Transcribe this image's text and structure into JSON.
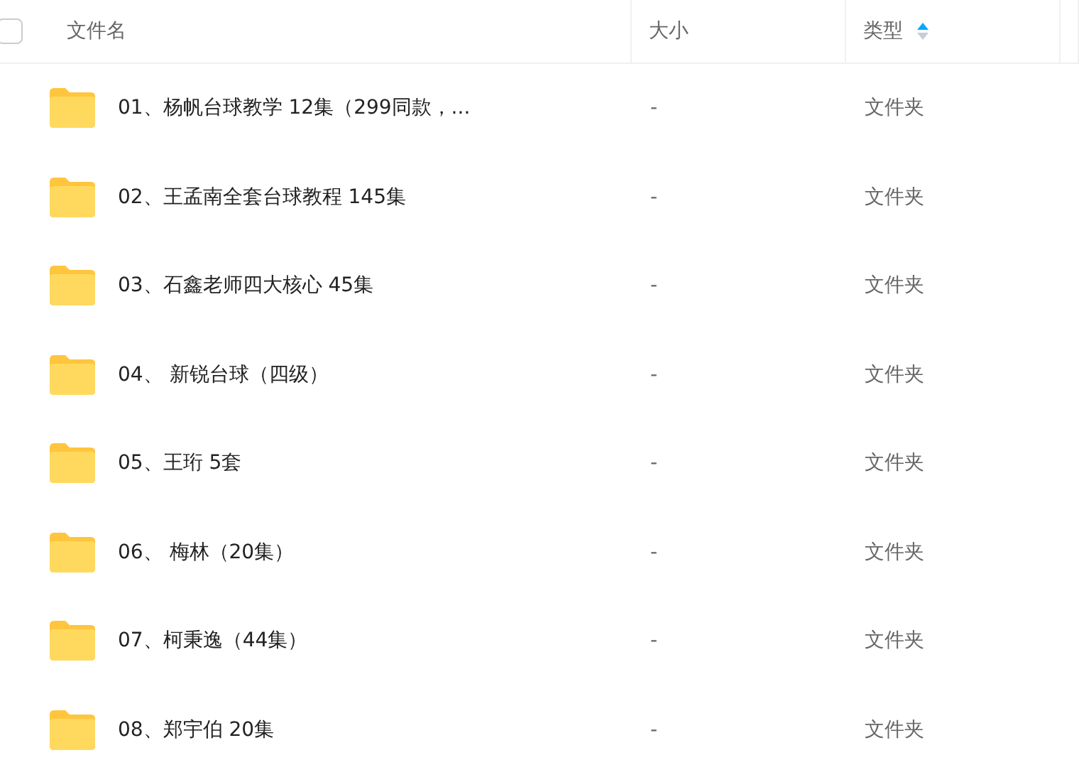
{
  "header": {
    "select_all": {
      "checked": false
    },
    "columns": [
      {
        "label": "文件名",
        "sorted": false
      },
      {
        "label": "大小",
        "sorted": false
      },
      {
        "label": "类型",
        "sorted": true
      }
    ]
  },
  "rows": [
    {
      "name": "01、杨帆台球教学 12集（299同款，...",
      "size": "-",
      "type": "文件夹"
    },
    {
      "name": "02、王孟南全套台球教程 145集",
      "size": "-",
      "type": "文件夹"
    },
    {
      "name": "03、石鑫老师四大核心 45集",
      "size": "-",
      "type": "文件夹"
    },
    {
      "name": "04、 新锐台球（四级）",
      "size": "-",
      "type": "文件夹"
    },
    {
      "name": "05、王珩 5套",
      "size": "-",
      "type": "文件夹"
    },
    {
      "name": "06、 梅林（20集）",
      "size": "-",
      "type": "文件夹"
    },
    {
      "name": "07、柯秉逸（44集）",
      "size": "-",
      "type": "文件夹"
    },
    {
      "name": "08、郑宇伯 20集",
      "size": "-",
      "type": "文件夹"
    }
  ]
}
